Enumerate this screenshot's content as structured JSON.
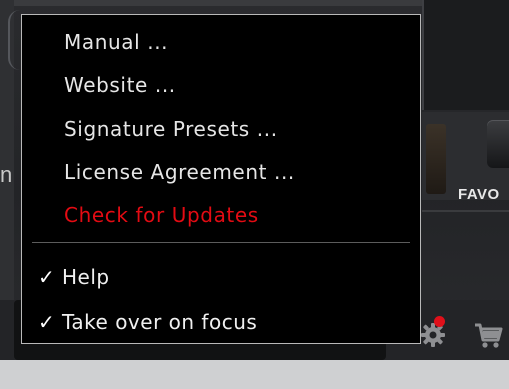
{
  "background": {
    "favorites_label_partial": "FAVO",
    "left_edge_letter": "n",
    "notification_color": "#e0101a"
  },
  "menu": {
    "items": [
      {
        "label": "Manual ..."
      },
      {
        "label": "Website ..."
      },
      {
        "label": "Signature Presets ..."
      },
      {
        "label": "License Agreement ..."
      },
      {
        "label": "Check for Updates",
        "color": "#e30b13"
      }
    ],
    "check_items": [
      {
        "label": "Help",
        "checked": true,
        "check_glyph": "✓"
      },
      {
        "label": "Take over on focus",
        "checked": true,
        "check_glyph": "✓"
      }
    ]
  },
  "icons": {
    "settings": "gear-icon",
    "cart": "cart-icon",
    "check": "checkmark-icon"
  }
}
